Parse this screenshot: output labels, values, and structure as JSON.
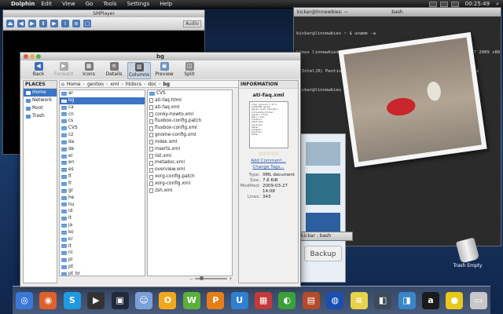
{
  "top_panel": {
    "app_name": "Dolphin",
    "menus": [
      "Edit",
      "View",
      "Go",
      "Tools",
      "Settings",
      "Help"
    ],
    "clock": "00:25:49"
  },
  "smplayer": {
    "title": "SMPlayer",
    "audio_label": "Audio"
  },
  "terminal": {
    "title_left": "kickar@linnewbies: ~",
    "title_mid": "bash",
    "lines": [
      "kickar@linnewbies ~ $ uname -a",
      "Linux linnewbies.com 2.6.27-gentoo-r8 #12 SMP Wed Apr 1 15:05:42 EDT 2009 x86_6",
      "4 Intel(R) Pentium(R) Dual CPU T3200 @ 2.00GHz GenuineIntel GNU/Linux",
      "kickar@linnewbies ~ $ "
    ]
  },
  "bg_window": {
    "backup_label": "Backup",
    "mini_terminal": "kickar : bash"
  },
  "dolphin": {
    "title": "bg",
    "toolbar": {
      "back": "Back",
      "forward": "Forward",
      "icons": "Icons",
      "details": "Details",
      "columns": "Columns",
      "preview": "Preview",
      "split": "Split"
    },
    "places": {
      "header": "PLACES",
      "items": [
        {
          "label": "Home",
          "selected": true
        },
        {
          "label": "Network",
          "selected": false
        },
        {
          "label": "Root",
          "selected": false
        },
        {
          "label": "Trash",
          "selected": false
        }
      ]
    },
    "breadcrumb": [
      "Home",
      "gentoo",
      "xml",
      "htdocs",
      "doc",
      "bg"
    ],
    "column1": [
      "ar",
      "bg",
      "ca",
      "cn",
      "cs",
      "CVS",
      "cz",
      "da",
      "de",
      "el",
      "en",
      "es",
      "fi",
      "fr",
      "gr",
      "he",
      "hu",
      "id",
      "it",
      "ja",
      "ko",
      "kr",
      "lt",
      "nl",
      "pl",
      "pt",
      "pt_br"
    ],
    "column1_selected": "bg",
    "column2": [
      {
        "name": "CVS",
        "folder": true
      },
      {
        "name": "ati-faq.html",
        "folder": false
      },
      {
        "name": "ati-faq.xml",
        "folder": false
      },
      {
        "name": "conky-howto.xml",
        "folder": false
      },
      {
        "name": "fluxbox-config.patch",
        "folder": false
      },
      {
        "name": "fluxbox-config.xml",
        "folder": false
      },
      {
        "name": "gnome-config.xml",
        "folder": false
      },
      {
        "name": "index.xml",
        "folder": false
      },
      {
        "name": "inserts.xml",
        "folder": false
      },
      {
        "name": "list.xml",
        "folder": false
      },
      {
        "name": "metadoc.xml",
        "folder": false
      },
      {
        "name": "overview.xml",
        "folder": false
      },
      {
        "name": "xorg-config.patch",
        "folder": false
      },
      {
        "name": "xorg-config.xml",
        "folder": false
      },
      {
        "name": "zsh.xml",
        "folder": false
      }
    ],
    "information": {
      "header": "INFORMATION",
      "file_name": "ati-faq.xml",
      "add_comment": "Add Comment...",
      "change_tags": "Change Tags...",
      "type_label": "Type:",
      "type_value": "XML document",
      "size_label": "Size:",
      "size_value": "7.6 KiB",
      "modified_label": "Modified:",
      "modified_value": "2009-03-27 14:08",
      "lines_label": "Lines:",
      "lines_value": "343",
      "rating": "☆☆☆☆☆"
    },
    "zoom_level": 0.2
  },
  "trash": {
    "label": "Trash Empty"
  },
  "dock": {
    "items": [
      {
        "name": "safari-icon",
        "color": "#3a78d8",
        "glyph": "◎"
      },
      {
        "name": "firefox-icon",
        "color": "#e0602a",
        "glyph": "◉"
      },
      {
        "name": "skype-icon",
        "color": "#1f9ae0",
        "glyph": "S"
      },
      {
        "name": "clapper-icon",
        "color": "#333333",
        "glyph": "▶"
      },
      {
        "name": "monitor-icon",
        "color": "#202a3a",
        "glyph": "▣"
      },
      {
        "name": "finder-icon",
        "color": "#7aa0d8",
        "glyph": "☺"
      },
      {
        "name": "office-icon-1",
        "color": "#f2a81c",
        "glyph": "O"
      },
      {
        "name": "office-icon-2",
        "color": "#5cb03a",
        "glyph": "W"
      },
      {
        "name": "office-icon-3",
        "color": "#e67e18",
        "glyph": "P"
      },
      {
        "name": "office-icon-4",
        "color": "#2f7fd2",
        "glyph": "U"
      },
      {
        "name": "gift-icon",
        "color": "#c23a3a",
        "glyph": "▦"
      },
      {
        "name": "chat-icon",
        "color": "#3aa03a",
        "glyph": "◐"
      },
      {
        "name": "firewall-icon",
        "color": "#b44a2a",
        "glyph": "▤"
      },
      {
        "name": "globe-icon",
        "color": "#1a4fb0",
        "glyph": "◍"
      },
      {
        "name": "notes-icon",
        "color": "#e8d24a",
        "glyph": "≡"
      },
      {
        "name": "mixer-icon",
        "color": "#3d4a5a",
        "glyph": "◧"
      },
      {
        "name": "network-icon",
        "color": "#3a86c8",
        "glyph": "◨"
      },
      {
        "name": "amazon-icon",
        "color": "#1a1a1a",
        "glyph": "a"
      },
      {
        "name": "bulb-icon",
        "color": "#e8c81a",
        "glyph": "●"
      },
      {
        "name": "computer-icon",
        "color": "#c8c8c8",
        "glyph": "▭"
      }
    ]
  }
}
